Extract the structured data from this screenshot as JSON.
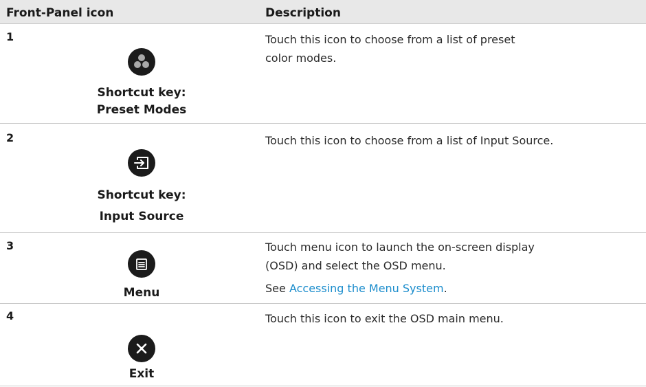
{
  "header": {
    "col1": "Front-Panel icon",
    "col2": "Description"
  },
  "rows": [
    {
      "number": "1",
      "icon": "preset-modes-icon",
      "caption_line1": "Shortcut key:",
      "caption_line2": "Preset Modes",
      "desc_line1": "Touch this icon to choose from a list of preset",
      "desc_line2": "color modes."
    },
    {
      "number": "2",
      "icon": "input-source-icon",
      "caption_line1": "Shortcut key:",
      "caption_line2": "Input Source",
      "desc_line1": "Touch this icon to choose from a list of Input Source."
    },
    {
      "number": "3",
      "icon": "menu-icon",
      "caption_line1": "Menu",
      "desc_line1": "Touch menu icon to launch the on-screen display",
      "desc_line2": "(OSD) and select the OSD menu.",
      "see_prefix": "See ",
      "see_link": "Accessing the Menu System",
      "see_suffix": "."
    },
    {
      "number": "4",
      "icon": "exit-icon",
      "caption_line1": "Exit",
      "desc_line1": "Touch this icon to exit the OSD main menu."
    }
  ],
  "colors": {
    "link": "#1a8ccc",
    "header_bg": "#e8e8e8",
    "icon_bg": "#1b1b1b"
  }
}
